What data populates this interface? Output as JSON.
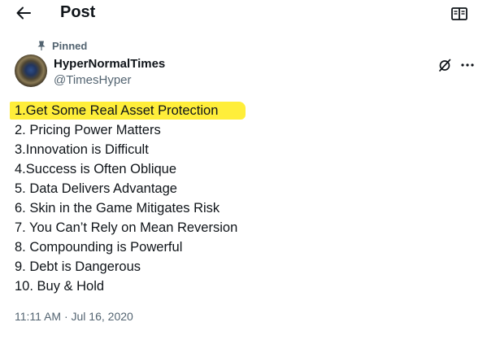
{
  "header": {
    "title": "Post",
    "back_icon": "arrow-left-icon",
    "reader_icon": "book-open-icon"
  },
  "pinned": {
    "label": "Pinned",
    "icon": "pin-icon"
  },
  "author": {
    "display_name": "HyperNormalTimes",
    "handle": "@TimesHyper",
    "avatar_icon": "avatar"
  },
  "actions": {
    "grok_icon": "grok-icon",
    "more_icon": "more-dots-icon"
  },
  "tweet": {
    "highlight_color": "#ffee3a",
    "lines": [
      "1.Get Some Real Asset Protection",
      "2. Pricing Power Matters",
      "3.Innovation is Difficult",
      "4.Success is Often Oblique",
      "5. Data Delivers Advantage",
      "6. Skin in the Game Mitigates Risk",
      "7. You Can’t Rely on Mean Reversion",
      "8. Compounding is Powerful",
      "9. Debt is Dangerous",
      "10. Buy & Hold"
    ]
  },
  "timestamp": "11:11 AM · Jul 16, 2020",
  "colors": {
    "text": "#0f1419",
    "secondary": "#536471",
    "background": "#ffffff"
  }
}
